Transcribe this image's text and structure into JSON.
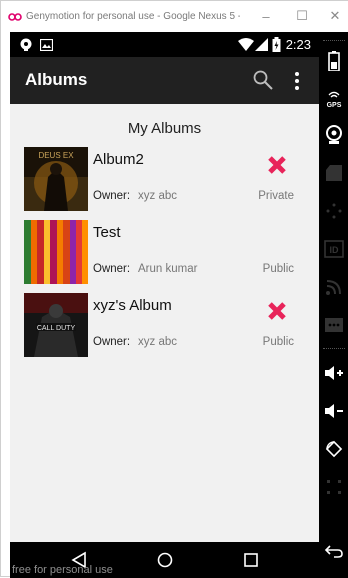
{
  "window": {
    "title": "Genymotion for personal use - Google Nexus 5 - ...",
    "minimize": "–",
    "maximize": "☐",
    "close": "✕"
  },
  "statusbar": {
    "time": "2:23"
  },
  "appbar": {
    "title": "Albums",
    "search_icon": "search-icon",
    "overflow_icon": "more-vertical-icon"
  },
  "content": {
    "section_title": "My Albums",
    "albums": [
      {
        "name": "Album2",
        "owner_label": "Owner:",
        "owner": "xyz abc",
        "privacy": "Private",
        "deletable": true,
        "thumb_text": "DEUS EX"
      },
      {
        "name": "Test",
        "owner_label": "Owner:",
        "owner": "Arun kumar",
        "privacy": "Public",
        "deletable": false
      },
      {
        "name": "xyz's Album",
        "owner_label": "Owner:",
        "owner": "xyz abc",
        "privacy": "Public",
        "deletable": true,
        "thumb_text": "CALL DUTY"
      }
    ]
  },
  "watermark": "free for personal use",
  "colors": {
    "appbar": "#212121",
    "background": "#f1f1f1",
    "delete": "#e8245a",
    "statusbar": "#000000"
  }
}
